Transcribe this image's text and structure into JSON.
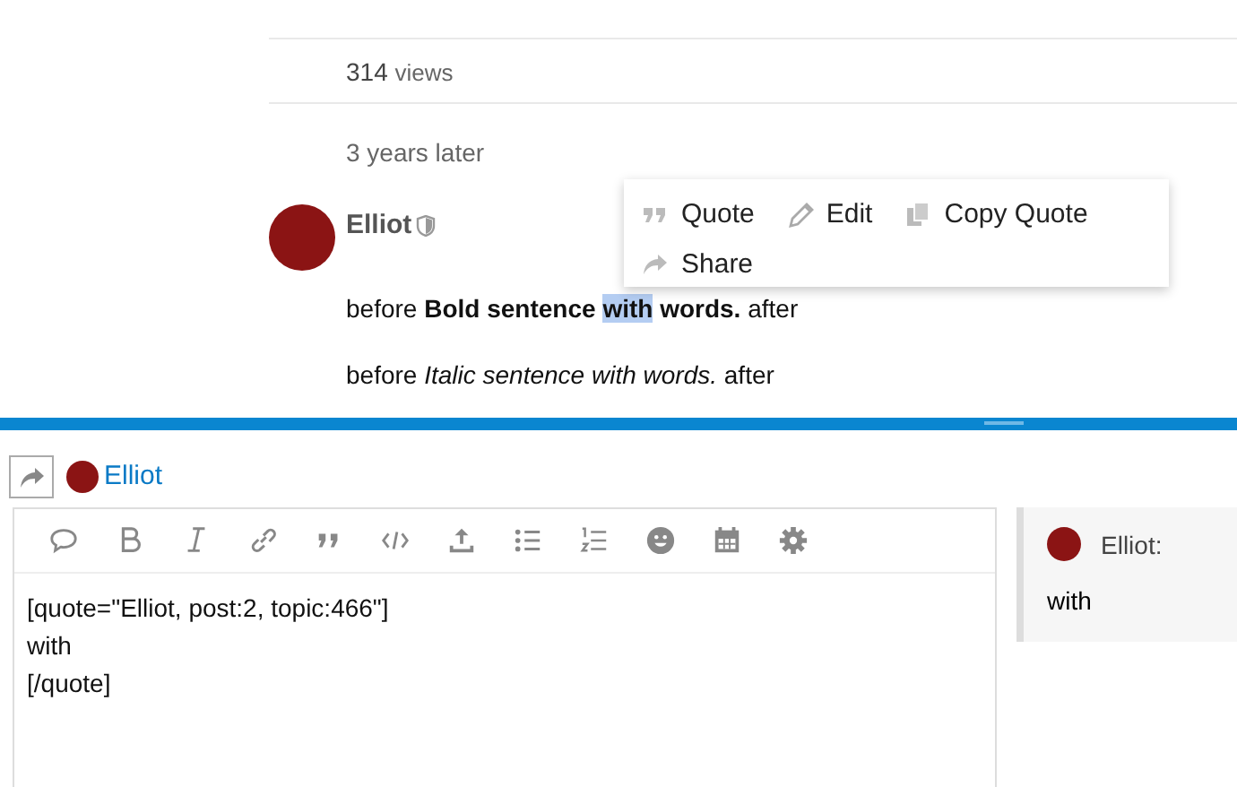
{
  "topic": {
    "views": {
      "count": "314",
      "label": "views"
    },
    "time_gap": "3 years later"
  },
  "post": {
    "author": "Elliot",
    "paragraphs": [
      {
        "segments": [
          {
            "text": "before **Bold sentence** ",
            "selected": false
          },
          {
            "text": "**with**",
            "selected": true
          },
          {
            "text": " **words.** after",
            "selected": false
          }
        ]
      },
      {
        "segments": [
          {
            "text": "before *Italic sentence with words.* after",
            "selected": false
          }
        ]
      }
    ]
  },
  "selection_menu": {
    "items": [
      {
        "label": "Quote",
        "kind": "quote"
      },
      {
        "label": "Edit",
        "kind": "edit"
      },
      {
        "label": "Copy Quote",
        "kind": "copy"
      },
      {
        "label": "Share",
        "kind": "share"
      }
    ]
  },
  "composer": {
    "reply_to": "Elliot",
    "text": "[quote=\"Elliot, post:2, topic:466\"]\nwith\n[/quote]",
    "preview": {
      "author": "Elliot:",
      "text": "with"
    }
  }
}
